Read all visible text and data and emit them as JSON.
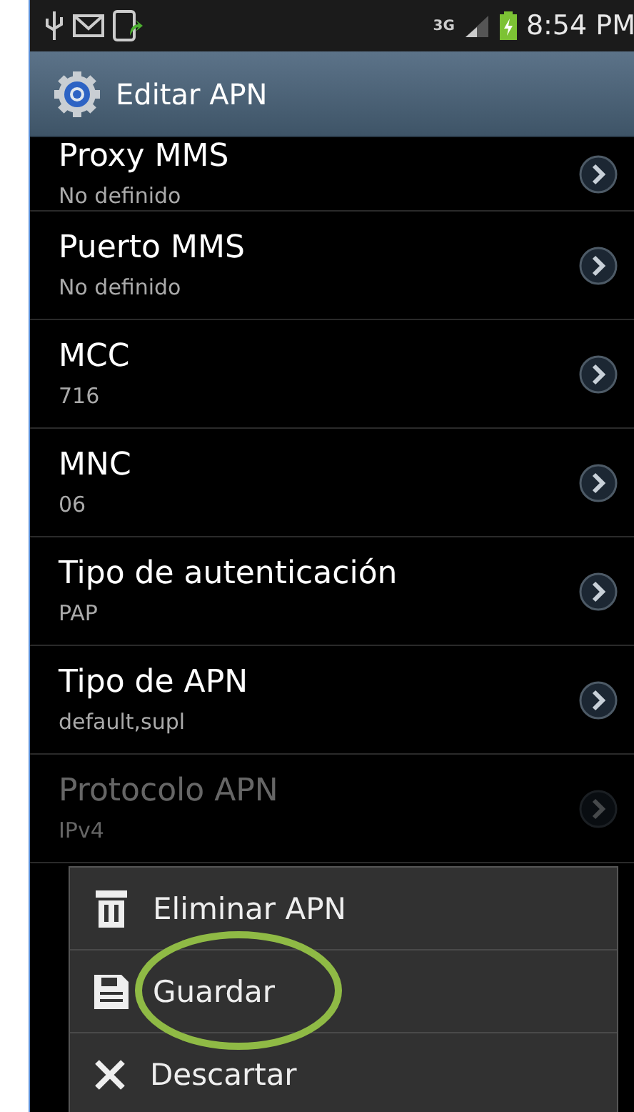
{
  "status_bar": {
    "network": "3G",
    "time": "8:54 PM"
  },
  "action_bar": {
    "title": "Editar APN"
  },
  "settings": [
    {
      "title": "Proxy MMS",
      "value": "No definido",
      "disabled": false
    },
    {
      "title": "Puerto MMS",
      "value": "No definido",
      "disabled": false
    },
    {
      "title": "MCC",
      "value": "716",
      "disabled": false
    },
    {
      "title": "MNC",
      "value": "06",
      "disabled": false
    },
    {
      "title": "Tipo de autenticación",
      "value": "PAP",
      "disabled": false
    },
    {
      "title": "Tipo de APN",
      "value": "default,supl",
      "disabled": false
    },
    {
      "title": "Protocolo APN",
      "value": "IPv4",
      "disabled": true
    }
  ],
  "menu": [
    {
      "kind": "delete",
      "label": "Eliminar APN"
    },
    {
      "kind": "save",
      "label": "Guardar"
    },
    {
      "kind": "discard",
      "label": "Descartar"
    }
  ]
}
